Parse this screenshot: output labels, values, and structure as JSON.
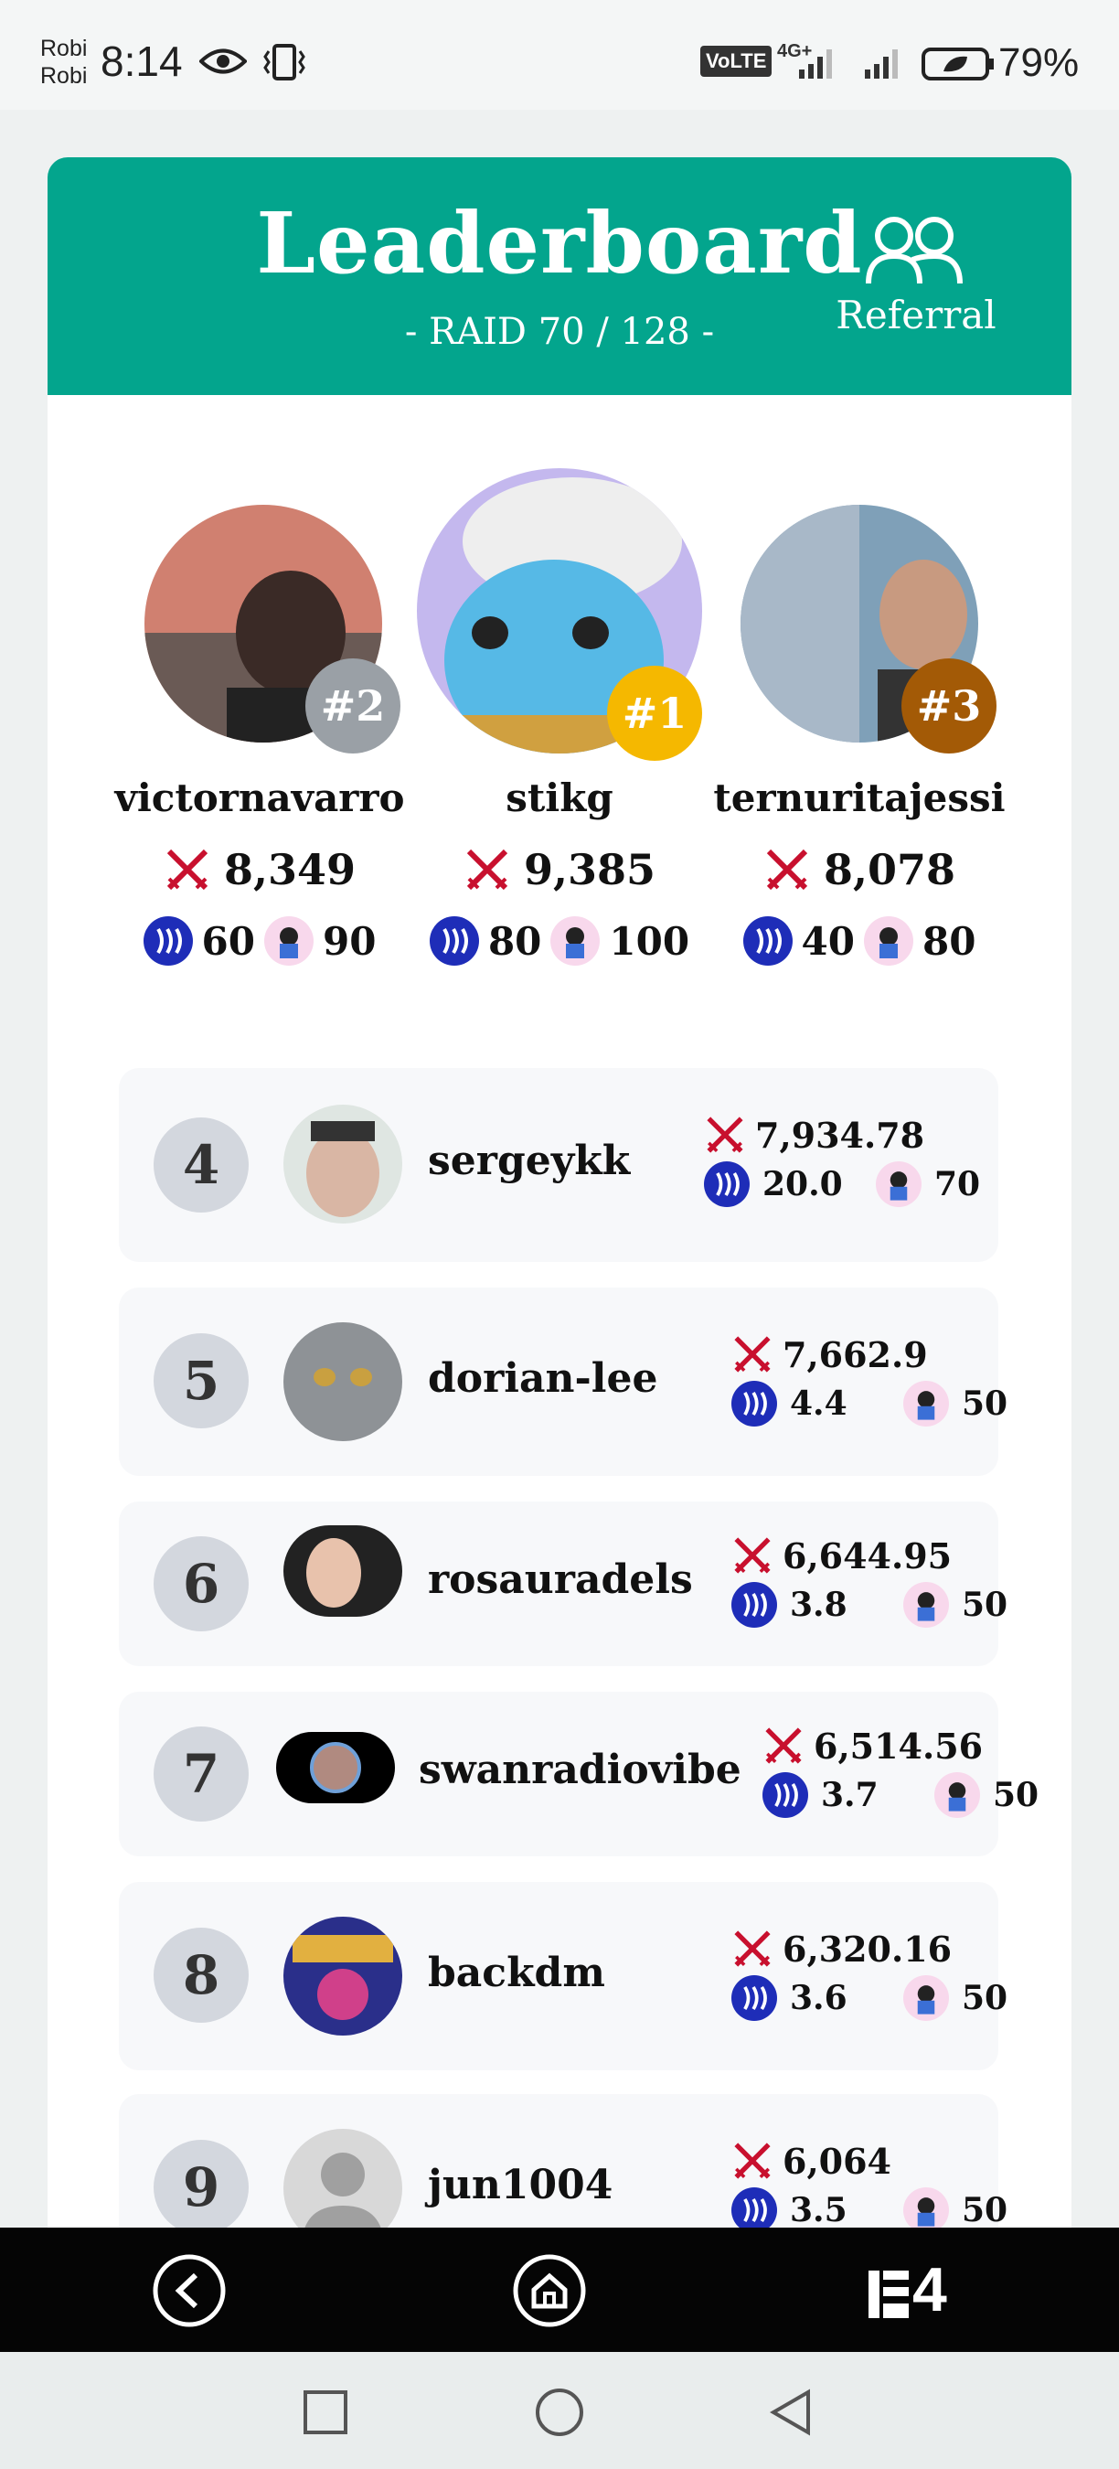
{
  "status_bar": {
    "carrier_line1": "Robi",
    "carrier_line2": "Robi",
    "time": "8:14",
    "volte": "VoLTE",
    "network": "4G+",
    "battery": "79%"
  },
  "header": {
    "title": "Leaderboard",
    "subtitle": "- RAID 70 / 128 -",
    "referral_label": "Referral",
    "accent_color": "#03a58d"
  },
  "podium": [
    {
      "rank": "#2",
      "name": "victornavarro",
      "score": "8,349",
      "sp": "60",
      "count": "90",
      "badge_color": "#9aa0a6"
    },
    {
      "rank": "#1",
      "name": "stikg",
      "score": "9,385",
      "sp": "80",
      "count": "100",
      "badge_color": "#f5b800"
    },
    {
      "rank": "#3",
      "name": "ternuritajessi",
      "score": "8,078",
      "sp": "40",
      "count": "80",
      "badge_color": "#a35a06"
    }
  ],
  "list": [
    {
      "rank": "4",
      "name": "sergeykk",
      "score": "7,934.78",
      "sp": "20.0",
      "count": "70"
    },
    {
      "rank": "5",
      "name": "dorian-lee",
      "score": "7,662.9",
      "sp": "4.4",
      "count": "50"
    },
    {
      "rank": "6",
      "name": "rosauradels",
      "score": "6,644.95",
      "sp": "3.8",
      "count": "50"
    },
    {
      "rank": "7",
      "name": "swanradiovibe",
      "score": "6,514.56",
      "sp": "3.7",
      "count": "50"
    },
    {
      "rank": "8",
      "name": "backdm",
      "score": "6,320.16",
      "sp": "3.6",
      "count": "50"
    },
    {
      "rank": "9",
      "name": "jun1004",
      "score": "6,064",
      "sp": "3.5",
      "count": "50"
    }
  ],
  "bottom_nav": {
    "back": "back-icon",
    "home": "home-icon",
    "brand_text": "4"
  }
}
